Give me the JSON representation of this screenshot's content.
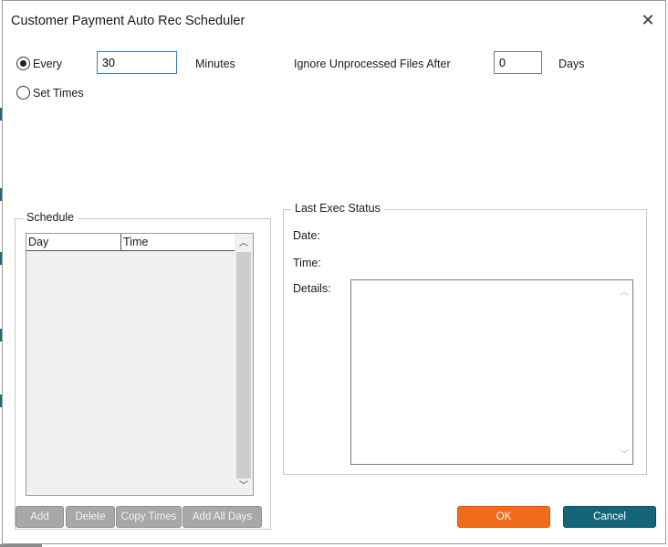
{
  "dialog": {
    "title": "Customer Payment Auto Rec Scheduler"
  },
  "interval": {
    "every_label": "Every",
    "every_value": "30",
    "minutes_label": "Minutes",
    "set_times_label": "Set Times",
    "selected": "Every"
  },
  "ignore": {
    "label": "Ignore Unprocessed Files After",
    "value": "0",
    "days_label": "Days"
  },
  "schedule": {
    "title": "Schedule",
    "columns": [
      "Day",
      "Time"
    ],
    "rows": [],
    "buttons": {
      "add": "Add",
      "delete": "Delete",
      "copy_times": "Copy Times",
      "add_all_days": "Add All Days"
    }
  },
  "last_exec": {
    "title": "Last Exec Status",
    "date_label": "Date:",
    "time_label": "Time:",
    "details_label": "Details:"
  },
  "footer": {
    "ok_label": "OK",
    "cancel_label": "Cancel"
  },
  "colors": {
    "ok": "#f26b1d",
    "cancel": "#136577",
    "disabled_button": "#a8a8a8"
  }
}
